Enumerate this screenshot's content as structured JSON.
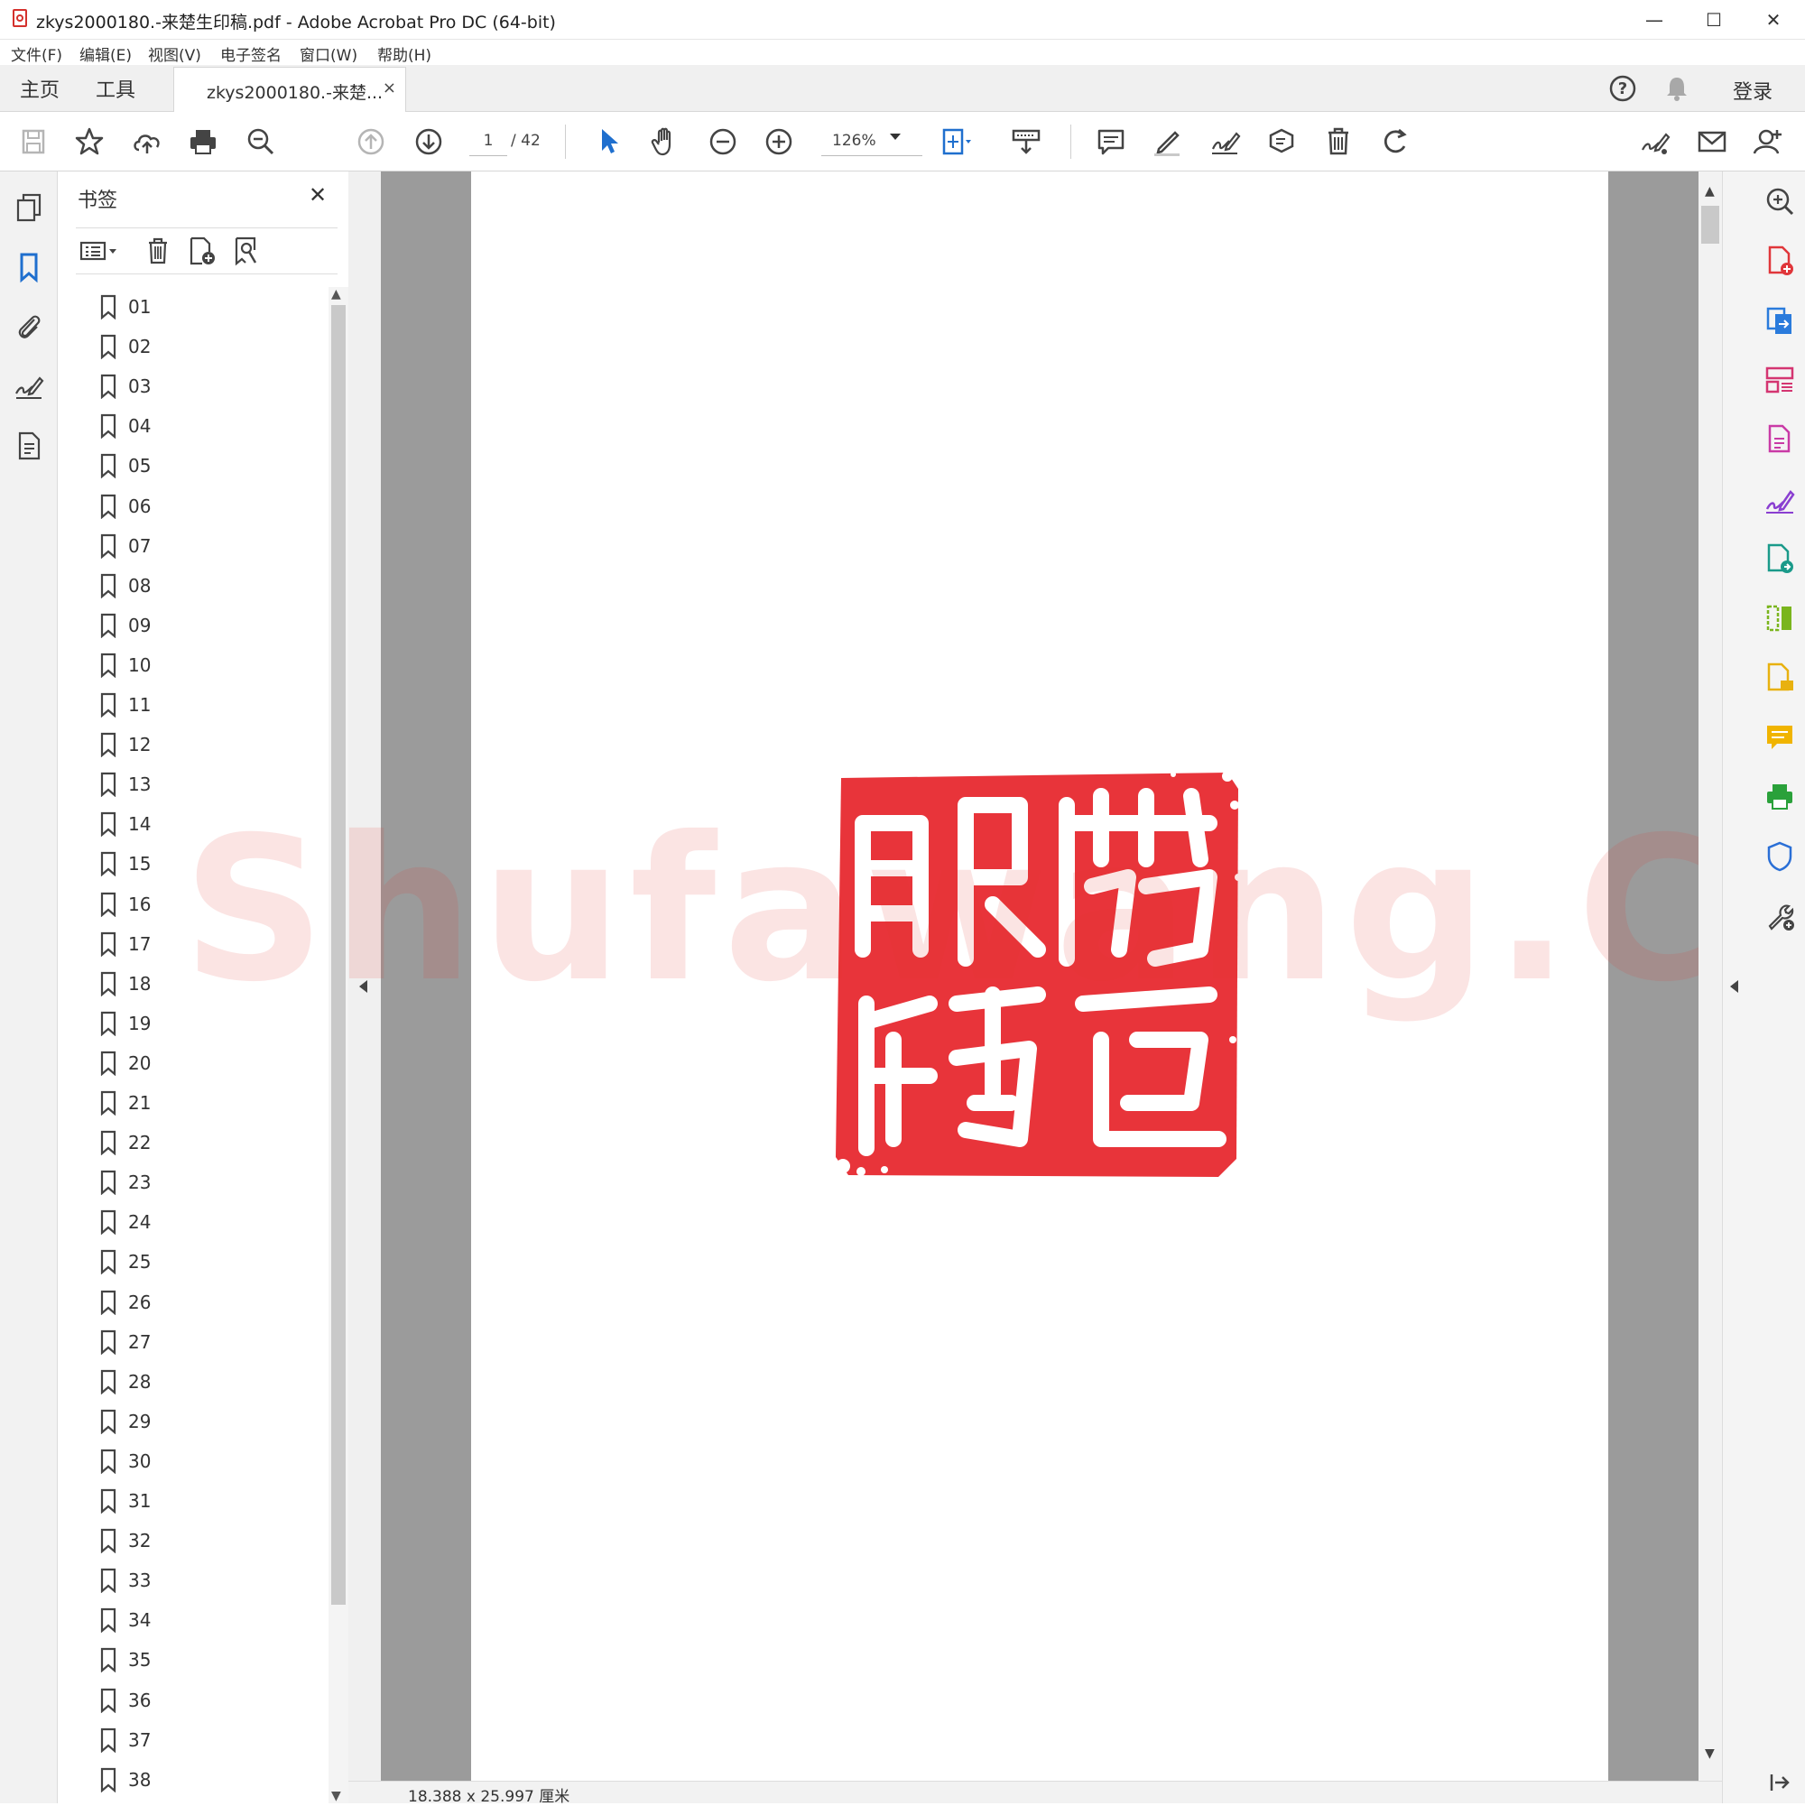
{
  "window": {
    "title": "zkys2000180.-来楚生印稿.pdf - Adobe Acrobat Pro DC (64-bit)",
    "minimize": "—",
    "maximize": "☐",
    "close": "✕"
  },
  "menu": [
    "文件(F)",
    "编辑(E)",
    "视图(V)",
    "电子签名",
    "窗口(W)",
    "帮助(H)"
  ],
  "tabs": {
    "home": "主页",
    "tools": "工具",
    "document": "zkys2000180.-来楚...",
    "close_symbol": "×",
    "login": "登录"
  },
  "toolbar": {
    "page_current": "1",
    "page_total": "/ 42",
    "zoom": "126%"
  },
  "bookmarks": {
    "title": "书签",
    "close_symbol": "✕",
    "items": [
      "01",
      "02",
      "03",
      "04",
      "05",
      "06",
      "07",
      "08",
      "09",
      "10",
      "11",
      "12",
      "13",
      "14",
      "15",
      "16",
      "17",
      "18",
      "19",
      "20",
      "21",
      "22",
      "23",
      "24",
      "25",
      "26",
      "27",
      "28",
      "29",
      "30",
      "31",
      "32",
      "33",
      "34",
      "35",
      "36",
      "37",
      "38"
    ]
  },
  "document": {
    "watermark": "Shufawang.CN",
    "seal_color": "#e8343a",
    "page_size": "18.388 x 25.997 厘米"
  },
  "colors": {
    "accent_blue": "#1f6fce",
    "acrobat_red": "#d4312d"
  },
  "left_rail_icons": [
    "pages-icon",
    "bookmark-icon",
    "attachment-icon",
    "signature-icon",
    "document-icon"
  ],
  "right_rail_icons": [
    "search-zoom-icon",
    "create-pdf-icon",
    "export-pdf-icon",
    "organize-pages-icon",
    "edit-pdf-icon",
    "fill-sign-icon",
    "send-for-signature-icon",
    "compare-icon",
    "scan-icon",
    "comment-icon",
    "print-production-icon",
    "protect-icon",
    "more-tools-icon"
  ]
}
